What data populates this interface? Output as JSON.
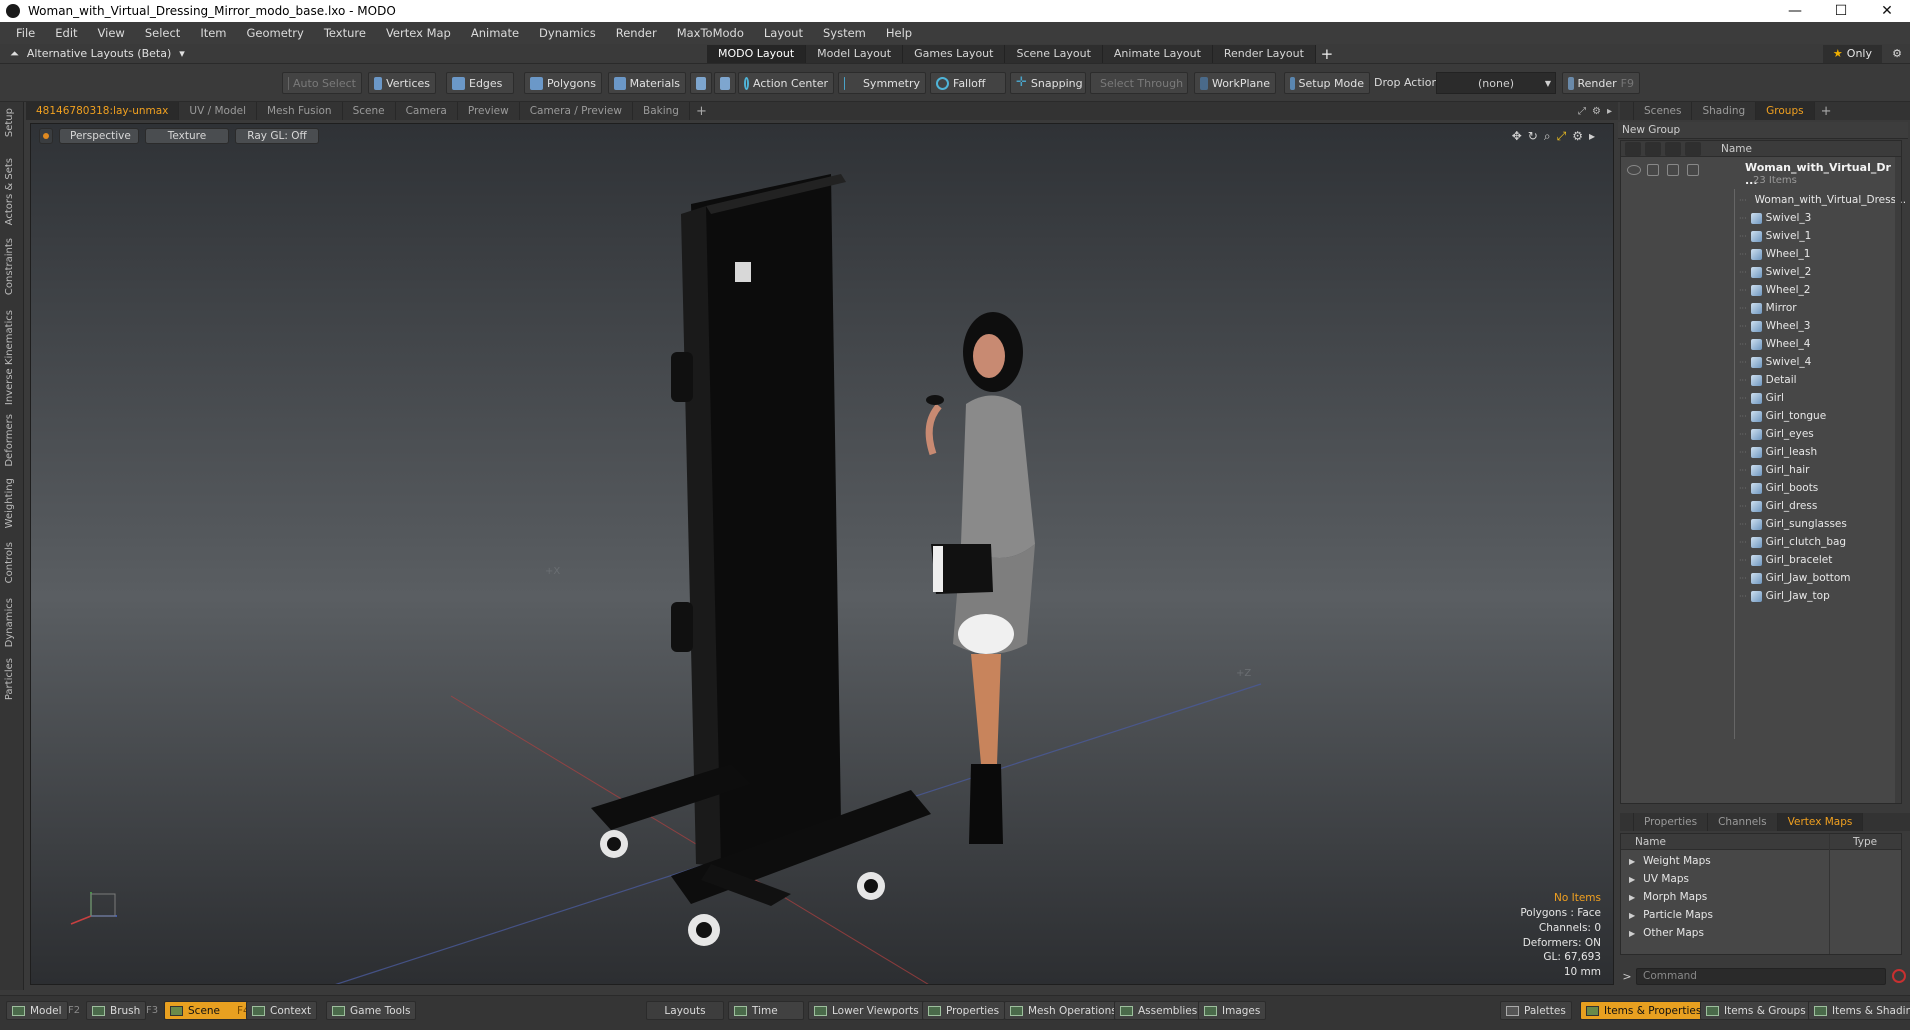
{
  "window": {
    "title": "Woman_with_Virtual_Dressing_Mirror_modo_base.lxo - MODO",
    "controls": [
      "—",
      "☐",
      "✕"
    ]
  },
  "menu": [
    "File",
    "Edit",
    "View",
    "Select",
    "Item",
    "Geometry",
    "Texture",
    "Vertex Map",
    "Animate",
    "Dynamics",
    "Render",
    "MaxToModo",
    "Layout",
    "System",
    "Help"
  ],
  "layoutbar": {
    "alt_layouts": "Alternative Layouts (Beta)",
    "tabs": [
      "MODO Layout",
      "Model Layout",
      "Games Layout",
      "Scene Layout",
      "Animate Layout",
      "Render Layout"
    ],
    "active_tab": "MODO Layout",
    "only": "Only"
  },
  "toolbar": {
    "auto_select": "Auto Select",
    "vertices": "Vertices",
    "edges": "Edges",
    "polygons": "Polygons",
    "materials": "Materials",
    "action_center": "Action Center",
    "symmetry": "Symmetry",
    "falloff": "Falloff",
    "snapping": "Snapping",
    "select_through": "Select Through",
    "workplane": "WorkPlane",
    "setup_mode": "Setup Mode",
    "drop_action": "Drop Action",
    "drop_value": "(none)",
    "render": "Render",
    "render_key": "F9"
  },
  "left_tabs": [
    "Setup",
    "Actors & Sets",
    "Constraints",
    "Inverse Kinematics",
    "Deformers",
    "Weighting",
    "Controls",
    "Dynamics",
    "Particles"
  ],
  "viewport_tabs": [
    "48146780318:lay-unmax",
    "UV / Model",
    "Mesh Fusion",
    "Scene",
    "Camera",
    "Preview",
    "Camera / Preview",
    "Baking"
  ],
  "viewport": {
    "view_mode": "Perspective",
    "shading": "Texture",
    "raygl": "Ray GL: Off",
    "info": {
      "no_items": "No Items",
      "polygons": "Polygons : Face",
      "channels": "Channels: 0",
      "deformers": "Deformers: ON",
      "gl": "GL: 67,693",
      "scale": "10 mm"
    },
    "axis_labels": {
      "x": "+X",
      "z": "+Z"
    }
  },
  "right_tabs": [
    "Scenes",
    "Shading",
    "Groups"
  ],
  "groups": {
    "new_group": "New Group",
    "col_name": "Name",
    "root_name": "Woman_with_Virtual_Dr ...",
    "root_count": "23 Items",
    "items": [
      "Woman_with_Virtual_Dress...",
      "Swivel_3",
      "Swivel_1",
      "Wheel_1",
      "Swivel_2",
      "Wheel_2",
      "Mirror",
      "Wheel_3",
      "Wheel_4",
      "Swivel_4",
      "Detail",
      "Girl",
      "Girl_tongue",
      "Girl_eyes",
      "Girl_leash",
      "Girl_hair",
      "Girl_boots",
      "Girl_dress",
      "Girl_sunglasses",
      "Girl_clutch_bag",
      "Girl_bracelet",
      "Girl_Jaw_bottom",
      "Girl_Jaw_top"
    ]
  },
  "props_tabs": [
    "Properties",
    "Channels",
    "Vertex Maps"
  ],
  "vertex_maps": {
    "col_name": "Name",
    "col_type": "Type",
    "items": [
      "Weight Maps",
      "UV Maps",
      "Morph Maps",
      "Particle Maps",
      "Other Maps"
    ]
  },
  "command": {
    "prompt": ">",
    "placeholder": "Command"
  },
  "bottombar": {
    "model": "Model",
    "model_key": "F2",
    "brush": "Brush",
    "brush_key": "F3",
    "scene": "Scene",
    "scene_key": "F4",
    "context": "Context",
    "game_tools": "Game Tools",
    "layouts": "Layouts",
    "time": "Time",
    "lower_viewports": "Lower Viewports",
    "properties": "Properties",
    "mesh_operations": "Mesh Operations",
    "assemblies": "Assemblies",
    "images": "Images",
    "palettes": "Palettes",
    "items_properties": "Items & Properties",
    "items_groups": "Items & Groups",
    "items_shading": "Items & Shading"
  }
}
